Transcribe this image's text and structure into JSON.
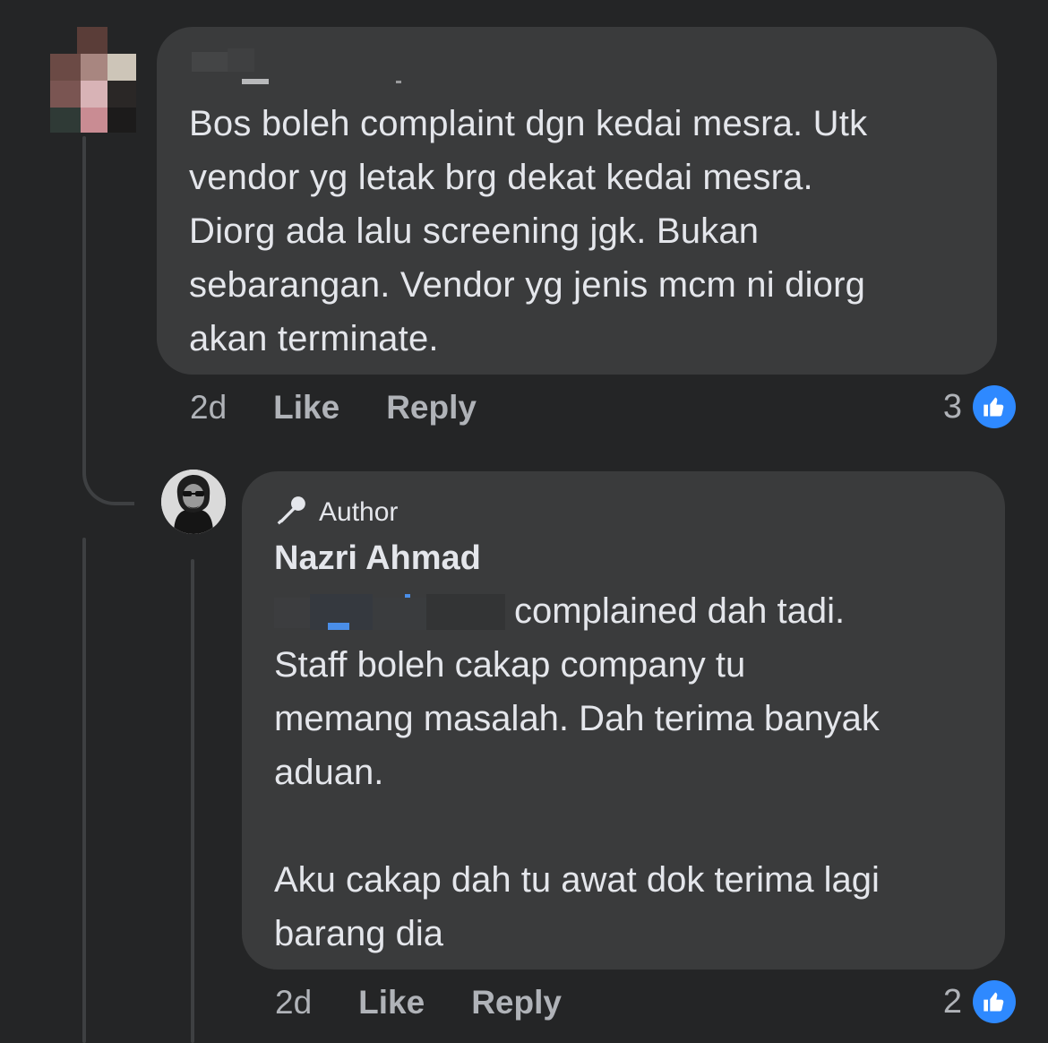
{
  "comment1": {
    "name_redacted": true,
    "text": "Bos boleh complaint dgn kedai mesra. Utk\nvendor yg letak brg dekat kedai mesra.\nDiorg ada lalu screening jgk. Bukan\nsebarangan. Vendor yg jenis mcm ni diorg\nakan terminate.",
    "time": "2d",
    "like_label": "Like",
    "reply_label": "Reply",
    "reaction_count": "3",
    "reaction_icon": "like-icon"
  },
  "comment2": {
    "badge_label": "Author",
    "badge_icon": "microphone-icon",
    "name": "Nazri Ahmad",
    "mention_redacted": true,
    "text": "complained dah tadi.\nStaff boleh cakap company tu\nmemang masalah. Dah terima banyak\naduan.\n\nAku cakap dah tu awat dok terima lagi\nbarang dia",
    "time": "2d",
    "like_label": "Like",
    "reply_label": "Reply",
    "reaction_count": "2",
    "reaction_icon": "like-icon"
  },
  "colors": {
    "background": "#242526",
    "bubble": "#3a3b3c",
    "text": "#e4e6eb",
    "secondary_text": "#b0b3b8",
    "like_blue": "#2e89ff"
  }
}
